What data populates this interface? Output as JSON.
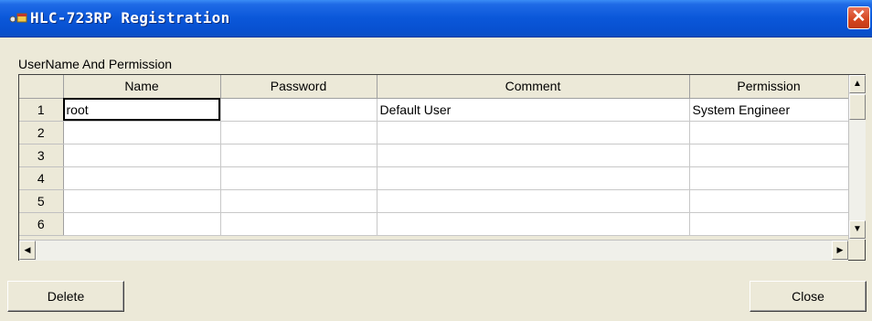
{
  "window": {
    "title": "HLC-723RP Registration",
    "close_glyph": "✕"
  },
  "group_label": "UserName And Permission",
  "grid": {
    "columns": [
      "Name",
      "Password",
      "Comment",
      "Permission"
    ],
    "rows": [
      {
        "num": "1",
        "name": "root",
        "password": "",
        "comment": "Default User",
        "permission": "System Engineer"
      },
      {
        "num": "2",
        "name": "",
        "password": "",
        "comment": "",
        "permission": ""
      },
      {
        "num": "3",
        "name": "",
        "password": "",
        "comment": "",
        "permission": ""
      },
      {
        "num": "4",
        "name": "",
        "password": "",
        "comment": "",
        "permission": ""
      },
      {
        "num": "5",
        "name": "",
        "password": "",
        "comment": "",
        "permission": ""
      },
      {
        "num": "6",
        "name": "",
        "password": "",
        "comment": "",
        "permission": ""
      }
    ]
  },
  "buttons": {
    "delete": "Delete",
    "close": "Close"
  },
  "scroll_glyphs": {
    "up": "▲",
    "down": "▼",
    "left": "◀",
    "right": "▶"
  },
  "icons": [
    "app-icon",
    "close-icon",
    "scroll-up-icon",
    "scroll-down-icon",
    "scroll-left-icon",
    "scroll-right-icon"
  ],
  "colors": {
    "titlebar": "#0a57d9",
    "close": "#d4451e",
    "face": "#ece9d8"
  }
}
